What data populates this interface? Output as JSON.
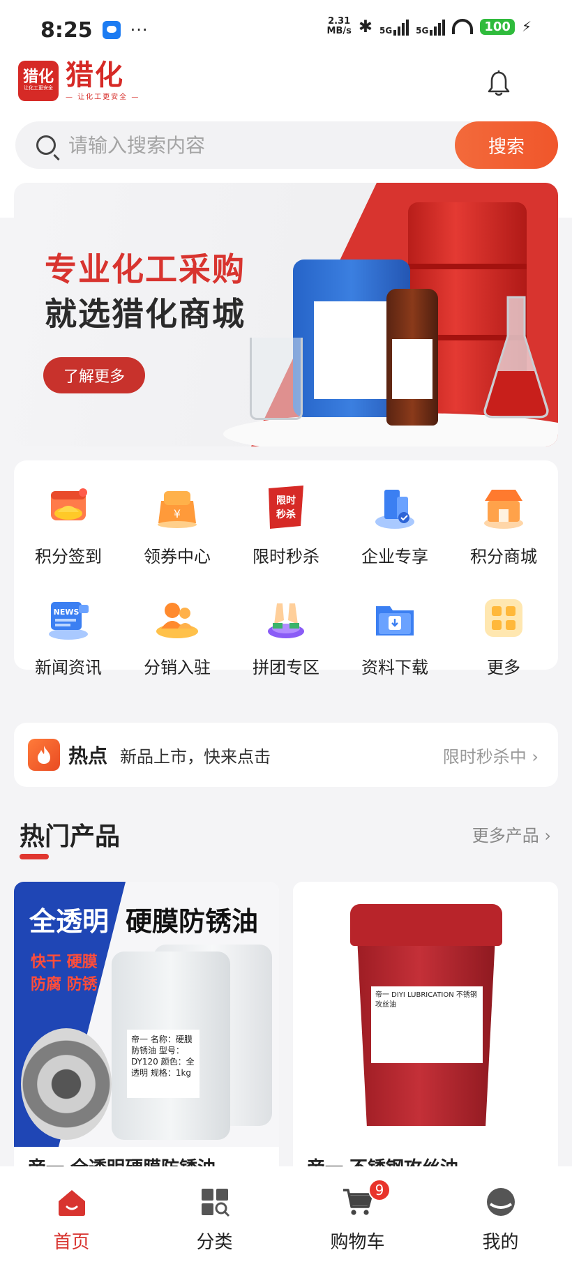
{
  "status_bar": {
    "time": "8:25",
    "dots": "···",
    "net_speed_value": "2.31",
    "net_speed_unit": "MB/s",
    "signal1": "5G",
    "signal2": "5G",
    "battery": "100"
  },
  "header": {
    "logo_box_text": "猎化",
    "logo_box_small": "让化工更安全",
    "logo_name": "猎化",
    "logo_slogan": "— 让化工更安全 —"
  },
  "search": {
    "placeholder": "请输入搜索内容",
    "button_label": "搜索"
  },
  "banner": {
    "title": "专业化工采购",
    "subtitle": "就选猎化商城",
    "button_label": "了解更多"
  },
  "grid": {
    "items": [
      {
        "label": "积分签到",
        "icon": "points-signin-icon"
      },
      {
        "label": "领券中心",
        "icon": "coupon-icon"
      },
      {
        "label": "限时秒杀",
        "icon": "flash-sale-icon",
        "badge": "限时秒杀"
      },
      {
        "label": "企业专享",
        "icon": "enterprise-icon"
      },
      {
        "label": "积分商城",
        "icon": "points-mall-icon"
      },
      {
        "label": "新闻资讯",
        "icon": "news-icon",
        "badge": "NEWS"
      },
      {
        "label": "分销入驻",
        "icon": "distribution-icon"
      },
      {
        "label": "拼团专区",
        "icon": "group-buy-icon"
      },
      {
        "label": "资料下载",
        "icon": "download-icon"
      },
      {
        "label": "更多",
        "icon": "more-icon"
      }
    ]
  },
  "hot": {
    "title": "热点",
    "text": "新品上市，快来点击",
    "link": "限时秒杀中 ›"
  },
  "section": {
    "title": "热门产品",
    "more": "更多产品 ›"
  },
  "products": [
    {
      "headline_white": "全透明",
      "headline_black": "硬膜防锈油",
      "tags": "快干 硬膜 防腐 防锈",
      "label_lines": "帝一 名称：硬膜防锈油 型号：DY120 颜色：全透明 规格：1kg",
      "title": "帝一 全透明硬膜防锈油"
    },
    {
      "label_lines": "帝一 DIYI LUBRICATION 不锈钢攻丝油",
      "title": "帝一 不锈钢攻丝油"
    }
  ],
  "tabbar": {
    "items": [
      {
        "label": "首页",
        "icon": "home-icon",
        "active": true
      },
      {
        "label": "分类",
        "icon": "category-icon"
      },
      {
        "label": "购物车",
        "icon": "cart-icon",
        "badge": "9"
      },
      {
        "label": "我的",
        "icon": "profile-icon"
      }
    ]
  },
  "colors": {
    "brand_red": "#d8342f",
    "search_button": "#f0562b",
    "page_bg": "#f4f4f6"
  }
}
